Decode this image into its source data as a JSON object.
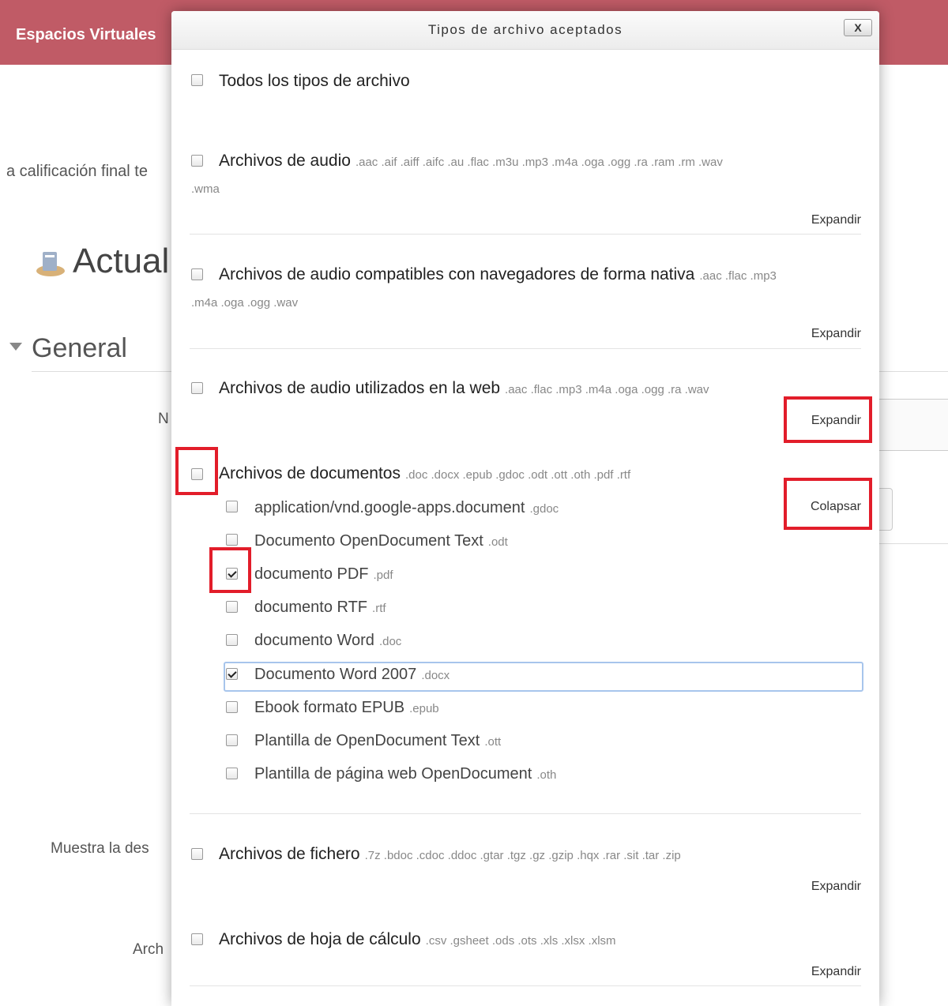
{
  "header": {
    "brand": "Espacios Virtuales"
  },
  "background": {
    "text1": "a calificación final te",
    "page_title": "Actual",
    "section": "General",
    "label_n": "N",
    "label_muestra": "Muestra la des",
    "label_arch": "Arch"
  },
  "modal": {
    "title": "Tipos de archivo aceptados",
    "close_label": "X",
    "expand_label": "Expandir",
    "collapse_label": "Colapsar",
    "all_types": {
      "label": "Todos los tipos de archivo",
      "checked": false
    },
    "groups": [
      {
        "label": "Archivos de audio",
        "exts": ".aac .aif .aiff .aifc .au .flac .m3u .mp3 .m4a .oga .ogg .ra .ram .rm .wav",
        "exts_wrap": ".wma",
        "action": "Expandir"
      },
      {
        "label": "Archivos de audio compatibles con navegadores de forma nativa",
        "exts": ".aac .flac .mp3",
        "exts_wrap": ".m4a .oga .ogg .wav",
        "action": "Expandir"
      },
      {
        "label": "Archivos de audio utilizados en la web",
        "exts": ".aac .flac .mp3 .m4a .oga .ogg .ra .wav",
        "action": "Expandir"
      },
      {
        "label": "Archivos de documentos",
        "exts": ".doc .docx .epub .gdoc .odt .ott .oth .pdf .rtf",
        "action": "Colapsar",
        "items": [
          {
            "label": "application/vnd.google-apps.document",
            "ext": ".gdoc",
            "checked": false
          },
          {
            "label": "Documento OpenDocument Text",
            "ext": ".odt",
            "checked": false
          },
          {
            "label": "documento PDF",
            "ext": ".pdf",
            "checked": true
          },
          {
            "label": "documento RTF",
            "ext": ".rtf",
            "checked": false
          },
          {
            "label": "documento Word",
            "ext": ".doc",
            "checked": false
          },
          {
            "label": "Documento Word 2007",
            "ext": ".docx",
            "checked": true
          },
          {
            "label": "Ebook formato EPUB",
            "ext": ".epub",
            "checked": false
          },
          {
            "label": "Plantilla de OpenDocument Text",
            "ext": ".ott",
            "checked": false
          },
          {
            "label": "Plantilla de página web OpenDocument",
            "ext": ".oth",
            "checked": false
          }
        ]
      },
      {
        "label": "Archivos de fichero",
        "exts": ".7z .bdoc .cdoc .ddoc .gtar .tgz .gz .gzip .hqx .rar .sit .tar .zip",
        "action": "Expandir"
      },
      {
        "label": "Archivos de hoja de cálculo",
        "exts": ".csv .gsheet .ods .ots .xls .xlsx .xlsm",
        "action": "Expandir"
      }
    ]
  },
  "colors": {
    "topbar": "#c05b66",
    "highlight": "#e21d2a",
    "focus": "#a7c5ec"
  }
}
